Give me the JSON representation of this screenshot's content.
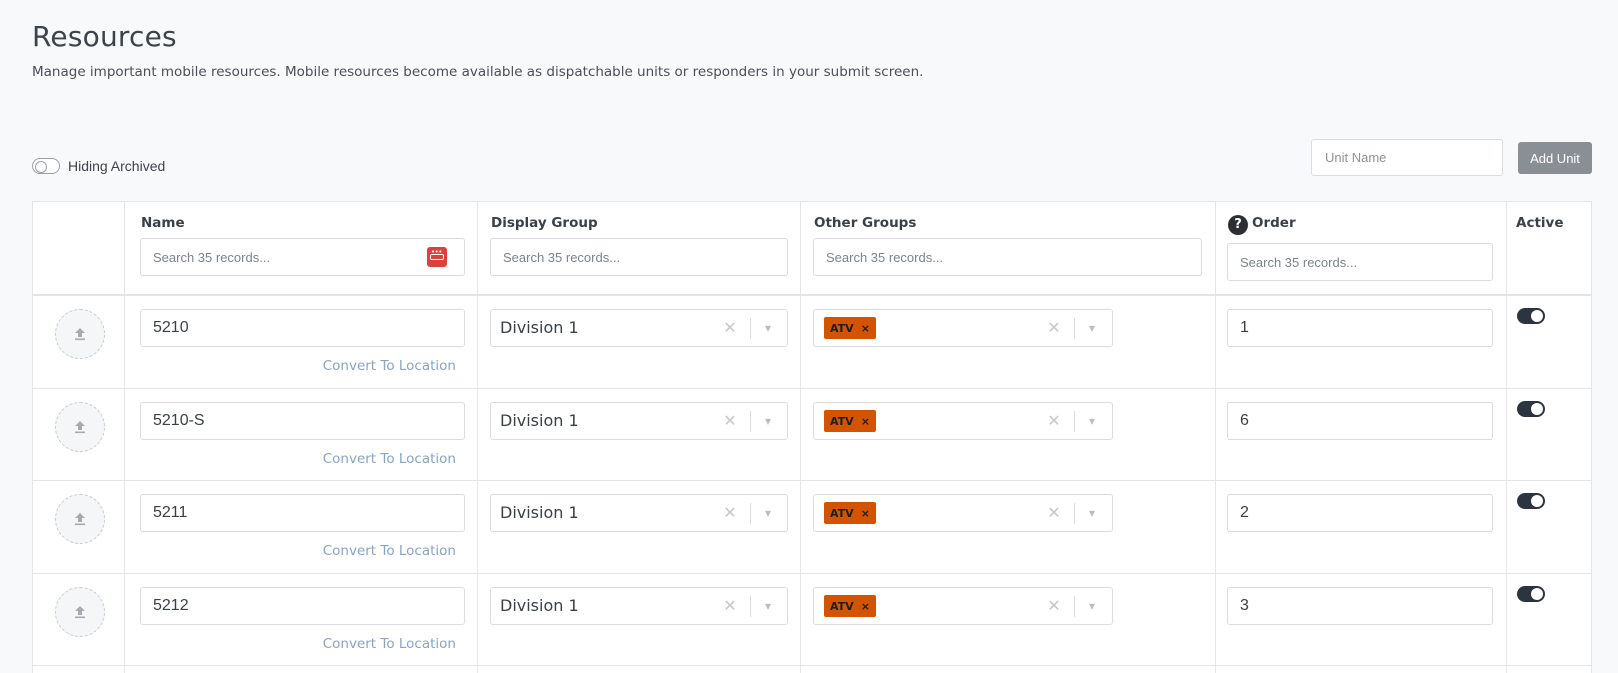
{
  "header": {
    "title": "Resources",
    "description": "Manage important mobile resources. Mobile resources become available as dispatchable units or responders in your submit screen."
  },
  "toolbar": {
    "archived_toggle_label": "Hiding Archived",
    "archived_toggle_on": false,
    "unit_name_placeholder": "Unit Name",
    "add_unit_label": "Add Unit"
  },
  "table": {
    "columns": {
      "name": "Name",
      "display_group": "Display Group",
      "other_groups": "Other Groups",
      "order": "Order",
      "active": "Active"
    },
    "search_placeholder": "Search 35 records...",
    "convert_label": "Convert To Location",
    "rows": [
      {
        "name": "5210",
        "display_group": "Division 1",
        "other_groups": [
          "ATV"
        ],
        "order": "1",
        "active": true
      },
      {
        "name": "5210-S",
        "display_group": "Division 1",
        "other_groups": [
          "ATV"
        ],
        "order": "6",
        "active": true
      },
      {
        "name": "5211",
        "display_group": "Division 1",
        "other_groups": [
          "ATV"
        ],
        "order": "2",
        "active": true
      },
      {
        "name": "5212",
        "display_group": "Division 1",
        "other_groups": [
          "ATV"
        ],
        "order": "3",
        "active": true
      }
    ]
  },
  "icons": {
    "upload": "upload-icon",
    "password_manager": "password-manager-icon",
    "help": "help-circle-icon",
    "clear": "clear-icon",
    "dropdown": "chevron-down-icon",
    "tag_remove": "close-icon"
  },
  "colors": {
    "tag_background": "#d35400",
    "add_button": "#8a8f95",
    "toggle_on": "#2c3440",
    "link": "#8aa4c0",
    "password_icon": "#d9423d"
  }
}
